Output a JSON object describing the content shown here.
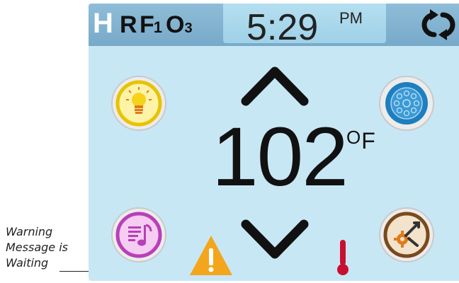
{
  "status_bar": {
    "mode_h": "H",
    "mode_r": "R",
    "mode_f": "F",
    "mode_f_sub": "1",
    "mode_o": "O",
    "mode_o_sub": "3",
    "time": "5:29",
    "ampm": "PM",
    "refresh_icon": "refresh-icon"
  },
  "temperature": {
    "value": "102",
    "degree_symbol": "O",
    "unit": "F"
  },
  "buttons": {
    "light": "light-bulb-icon",
    "jets": "jets-icon",
    "music": "music-icon",
    "settings": "settings-icon",
    "up": "up-arrow-icon",
    "down": "down-arrow-icon"
  },
  "indicators": {
    "warning": "warning-icon",
    "thermometer": "thermometer-icon"
  },
  "annotation": {
    "line1": "Warning",
    "line2": "Message is",
    "line3": "Waiting"
  },
  "colors": {
    "screen_bg": "#c8e7f5",
    "status_bar": "#82b3d1",
    "light_accent": "#e8c300",
    "jets_accent": "#1d7fc0",
    "music_accent": "#b93fb8",
    "settings_accent": "#7a4a1c",
    "warning": "#f3a61b",
    "thermometer": "#c8102e"
  }
}
